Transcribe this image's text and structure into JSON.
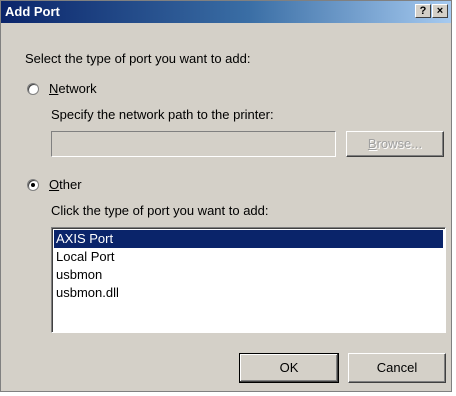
{
  "window": {
    "title": "Add Port",
    "help_button": "?",
    "close_button": "×"
  },
  "prompt": "Select the type of port you want to add:",
  "network": {
    "label_accel": "N",
    "label_rest": "etwork",
    "selected": false,
    "path_label": "Specify the network path to the printer:",
    "path_value": "",
    "browse_accel": "B",
    "browse_rest": "rowse..."
  },
  "other": {
    "label_accel": "O",
    "label_rest": "ther",
    "selected": true,
    "list_label": "Click the type of port you want to add:",
    "ports": [
      "AXIS Port",
      "Local Port",
      "usbmon",
      "usbmon.dll"
    ],
    "selected_port": "AXIS Port"
  },
  "buttons": {
    "ok": "OK",
    "cancel": "Cancel"
  }
}
